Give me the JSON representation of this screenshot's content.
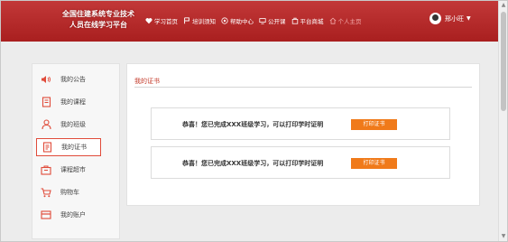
{
  "header": {
    "logo_line1": "全国住建系统专业技术",
    "logo_line2": "人员在线学习平台",
    "nav": [
      {
        "label": "学习首页",
        "icon": "heart-icon"
      },
      {
        "label": "培训须知",
        "icon": "flag-icon"
      },
      {
        "label": "帮助中心",
        "icon": "help-icon"
      },
      {
        "label": "公开课",
        "icon": "monitor-icon"
      },
      {
        "label": "平台商城",
        "icon": "shop-icon"
      },
      {
        "label": "个人主页",
        "icon": "home-icon"
      }
    ],
    "user_name": "邢小旺"
  },
  "sidebar": {
    "items": [
      {
        "label": "我的公告",
        "icon": "speaker-icon"
      },
      {
        "label": "我的课程",
        "icon": "book-icon"
      },
      {
        "label": "我的班级",
        "icon": "user-icon"
      },
      {
        "label": "我的证书",
        "icon": "certificate-icon",
        "active": true
      },
      {
        "label": "课程超市",
        "icon": "store-icon"
      },
      {
        "label": "购物车",
        "icon": "cart-icon"
      },
      {
        "label": "我的账户",
        "icon": "account-icon"
      }
    ]
  },
  "main": {
    "title": "我的证书",
    "certificates": [
      {
        "message": "恭喜！您已完成XXX班级学习，可以打印学时证明",
        "button": "打印证书"
      },
      {
        "message": "恭喜！您已完成XXX班级学习，可以打印学时证明",
        "button": "打印证书"
      }
    ]
  },
  "colors": {
    "header_red": "#b52a2a",
    "accent_red": "#c43a2a",
    "button_orange": "#f07a1a"
  }
}
